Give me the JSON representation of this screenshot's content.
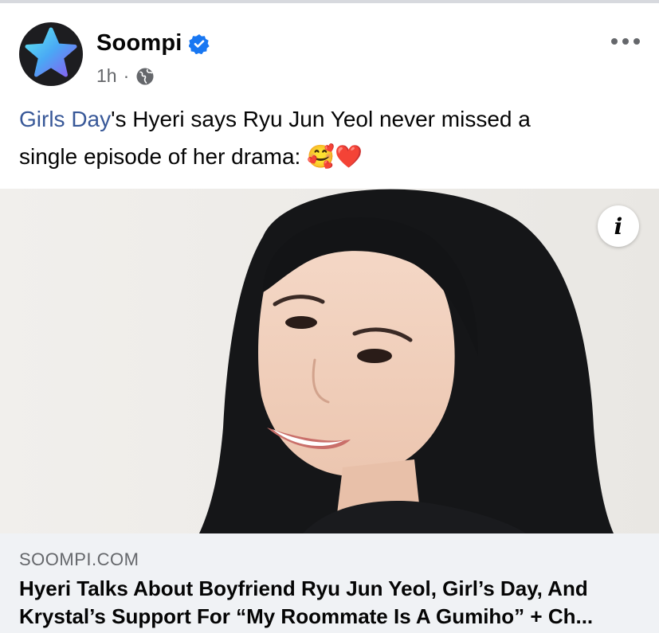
{
  "post": {
    "author": "Soompi",
    "verified": true,
    "time": "1h",
    "separator": "·",
    "audience_icon": "globe-icon",
    "more_icon": "more-options-icon",
    "text_link": "Girls Day",
    "text_rest": "'s Hyeri says Ryu Jun Yeol never missed a",
    "text_line2": "single episode of her drama: 🥰❤️"
  },
  "media": {
    "info_label": "i"
  },
  "link_preview": {
    "domain": "SOOMPI.COM",
    "headline_line1": "Hyeri Talks About Boyfriend Ryu Jun Yeol, Girl’s Day, And",
    "headline_line2": "Krystal’s Support For “My Roommate Is A Gumiho” + Ch..."
  },
  "colors": {
    "link": "#385898",
    "verified_badge": "#1877f2",
    "secondary_text": "#65676b",
    "preview_bg": "#f0f2f5"
  }
}
